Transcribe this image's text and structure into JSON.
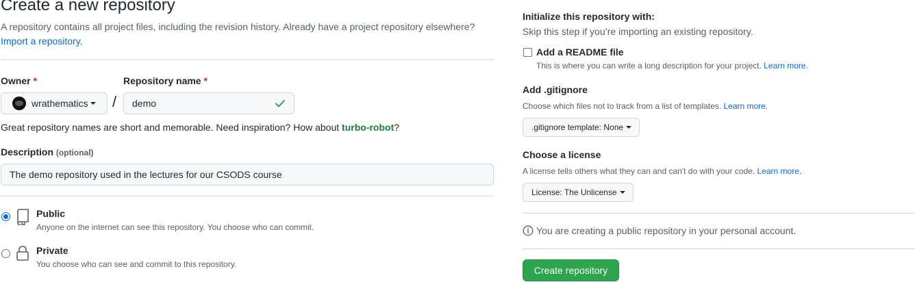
{
  "header": {
    "title": "Create a new repository",
    "subtitle": "A repository contains all project files, including the revision history. Already have a project repository elsewhere?",
    "import_link": "Import a repository."
  },
  "owner": {
    "label": "Owner",
    "required_mark": "*",
    "value": "wrathematics"
  },
  "separator": "/",
  "repo_name": {
    "label": "Repository name",
    "required_mark": "*",
    "value": "demo",
    "valid_icon": "check-icon"
  },
  "suggestion": {
    "text_before": "Great repository names are short and memorable. Need inspiration? How about ",
    "name": "turbo-robot",
    "text_after": "?"
  },
  "description": {
    "label": "Description",
    "optional": "(optional)",
    "value": "The demo repository used in the lectures for our CSODS course"
  },
  "visibility": {
    "public": {
      "label": "Public",
      "desc": "Anyone on the internet can see this repository. You choose who can commit.",
      "checked": true,
      "icon": "repo-icon"
    },
    "private": {
      "label": "Private",
      "desc": "You choose who can see and commit to this repository.",
      "checked": false,
      "icon": "lock-icon"
    }
  },
  "init": {
    "title": "Initialize this repository with:",
    "subtitle": "Skip this step if you’re importing an existing repository.",
    "readme": {
      "label": "Add a README file",
      "desc": "This is where you can write a long description for your project.",
      "learn_more": "Learn more.",
      "checked": false
    },
    "gitignore": {
      "title": "Add .gitignore",
      "desc": "Choose which files not to track from a list of templates.",
      "learn_more": "Learn more.",
      "button": ".gitignore template: None"
    },
    "license": {
      "title": "Choose a license",
      "desc": "A license tells others what they can and can't do with your code.",
      "learn_more": "Learn more.",
      "button": "License: The Unlicense"
    }
  },
  "notice": {
    "text": "You are creating a public repository in your personal account.",
    "icon": "info-icon"
  },
  "submit": {
    "label": "Create repository"
  },
  "colors": {
    "accent_blue": "#0969da",
    "success_green": "#2da44e",
    "suggestion_green": "#1a7f37",
    "required_red": "#cf222e"
  }
}
